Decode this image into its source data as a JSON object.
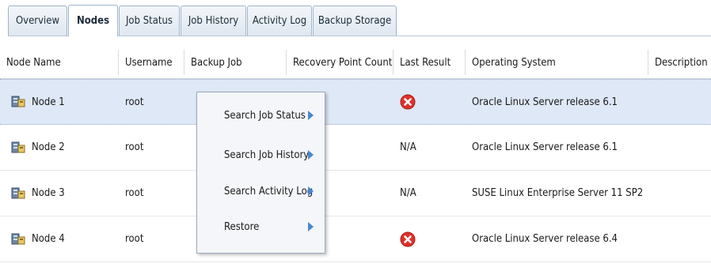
{
  "tabs": [
    {
      "label": "Overview",
      "active": false
    },
    {
      "label": "Nodes",
      "active": true
    },
    {
      "label": "Job Status",
      "active": false
    },
    {
      "label": "Job History",
      "active": false
    },
    {
      "label": "Activity Log",
      "active": false
    },
    {
      "label": "Backup Storage",
      "active": false
    }
  ],
  "columns": {
    "node_name": "Node Name",
    "username": "Username",
    "backup_job": "Backup Job",
    "recovery_point_count": "Recovery Point Count",
    "last_result": "Last Result",
    "operating_system": "Operating System",
    "description": "Description"
  },
  "rows": [
    {
      "node_name": "Node 1",
      "username": "root",
      "last_result": "",
      "last_result_icon": "error-icon",
      "operating_system": "Oracle Linux Server release 6.1",
      "selected": true
    },
    {
      "node_name": "Node 2",
      "username": "root",
      "last_result": "N/A",
      "last_result_icon": "",
      "operating_system": "Oracle Linux Server release 6.1",
      "selected": false
    },
    {
      "node_name": "Node 3",
      "username": "root",
      "last_result": "N/A",
      "last_result_icon": "",
      "operating_system": "SUSE Linux Enterprise Server 11 SP2",
      "selected": false
    },
    {
      "node_name": "Node 4",
      "username": "root",
      "last_result": "",
      "last_result_icon": "error-icon",
      "operating_system": "Oracle Linux Server release 6.4",
      "selected": false
    }
  ],
  "context_menu": {
    "items": [
      {
        "label": "Search Job Status",
        "submenu": true
      },
      {
        "label": "Search Job History",
        "submenu": true
      },
      {
        "label": "Search Activity Log",
        "submenu": true
      },
      {
        "label": "Restore",
        "submenu": true
      }
    ]
  },
  "colors": {
    "selection": "#dfe8f6",
    "error": "#e0302a",
    "submenu_arrow": "#4a86d0"
  }
}
